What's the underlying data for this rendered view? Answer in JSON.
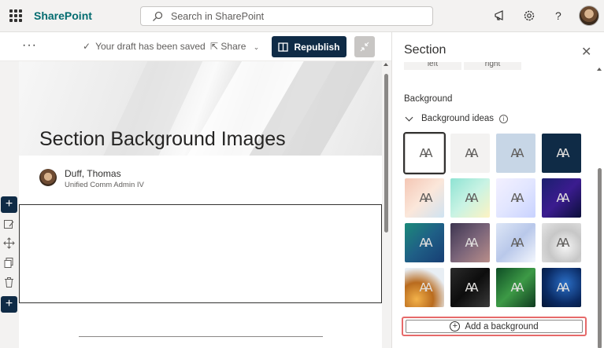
{
  "app": {
    "brand": "SharePoint"
  },
  "search": {
    "placeholder": "Search in SharePoint"
  },
  "command_bar": {
    "more_label": "···",
    "draft_status": "Your draft has been saved",
    "share_label": "Share",
    "republish_label": "Republish"
  },
  "page": {
    "title": "Section Background Images",
    "author_name": "Duff, Thomas",
    "author_role": "Unified Comm Admin IV"
  },
  "panel": {
    "title": "Section",
    "close_glyph": "✕",
    "left_label": "left",
    "right_label": "right",
    "background_label": "Background",
    "ideas_label": "Background ideas",
    "info_glyph": "i",
    "tile_glyph": "AA",
    "add_background_label": "Add a background",
    "tiles": [
      {
        "name": "white",
        "bg": "#ffffff",
        "selected": true
      },
      {
        "name": "light-gray",
        "bg": "#f3f2f1"
      },
      {
        "name": "light-blue",
        "bg": "#c7d6e6"
      },
      {
        "name": "navy",
        "bg": "#0f2b46"
      },
      {
        "name": "peach-gradient",
        "bg": "linear-gradient(135deg,#f4c6b4,#fbe7da,#cfe3f2)"
      },
      {
        "name": "mint-gradient",
        "bg": "linear-gradient(135deg,#8ee3d3,#c9f3e4,#fdf3c2)"
      },
      {
        "name": "lavender-gradient",
        "bg": "linear-gradient(135deg,#f3f0ff,#e2e6ff,#c8d2ff)"
      },
      {
        "name": "purple-night",
        "bg": "linear-gradient(135deg,#1a1f6e,#3b1c8f,#0b0f3a)"
      },
      {
        "name": "teal-gradient",
        "bg": "linear-gradient(135deg,#1c8a7a,#1f5f86,#173e74)"
      },
      {
        "name": "mauve-gradient",
        "bg": "linear-gradient(135deg,#3d3550,#7a6479,#b98e8a)"
      },
      {
        "name": "silk-blue",
        "bg": "linear-gradient(135deg,#dde6f6,#b9c8ea,#f3f6fd)"
      },
      {
        "name": "gray-blur",
        "bg": "radial-gradient(circle at 60% 60%,#f5f5f5,#c7c7c7,#e5e5e5)"
      },
      {
        "name": "gold-bokeh",
        "bg": "radial-gradient(circle at 30% 80%,#f3b24a,#b96b1e 40%,#e8eef4 75%)"
      },
      {
        "name": "black-texture",
        "bg": "linear-gradient(135deg,#2a2a2a,#0d0d0d,#3a3a3a)"
      },
      {
        "name": "green-wave",
        "bg": "linear-gradient(135deg,#0e4d25,#3d9a46,#0f3b1f)"
      },
      {
        "name": "blue-network",
        "bg": "radial-gradient(circle at 60% 40%,#2b6fc7,#0a2a63 60%,#051634)"
      }
    ]
  },
  "colors": {
    "brand_teal": "#036c70",
    "navy_button": "#0f2b46",
    "highlight_red": "#e66a6a"
  }
}
